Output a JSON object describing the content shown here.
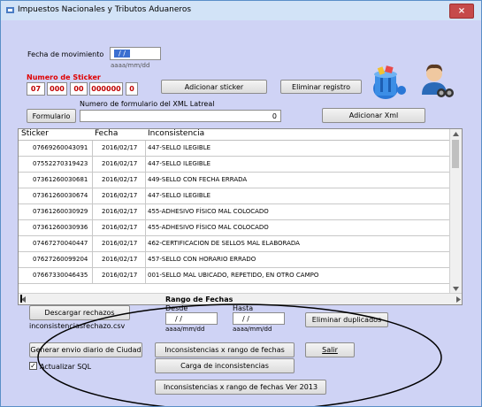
{
  "window": {
    "title": "Impuestos Nacionales y Tributos Aduaneros",
    "close_label": "×"
  },
  "fecha": {
    "label": "Fecha de movimiento",
    "value": " / /",
    "format": "aaaa/mm/dd"
  },
  "sticker": {
    "label": "Numero de Sticker",
    "parts": [
      "07",
      "000",
      "00",
      "000000",
      "0"
    ]
  },
  "buttons": {
    "adicionar_sticker": "Adicionar sticker",
    "eliminar_registro": "Eliminar registro",
    "formulario": "Formulario",
    "adicionar_xml": "Adicionar Xml",
    "descargar_rechazos": "Descargar rechazos",
    "eliminar_duplicados": "Eliminar duplicados",
    "generar_envio": "Generar envio diario de Ciudad",
    "inconsistencias_rango": "Inconsistencias x rango de fechas",
    "salir": "Salir",
    "carga_inconsistencias": "Carga de inconsistencias",
    "inconsistencias_2013": "Inconsistencias x rango de fechas Ver 2013"
  },
  "formulario": {
    "label": "Numero de formulario del XML Latreal",
    "value": "0"
  },
  "table": {
    "headers": [
      "Sticker",
      "Fecha",
      "Inconsistencia"
    ],
    "rows": [
      [
        "07669260043091",
        "2016/02/17",
        "447-SELLO ILEGIBLE"
      ],
      [
        "07552270319423",
        "2016/02/17",
        "447-SELLO ILEGIBLE"
      ],
      [
        "07361260030681",
        "2016/02/17",
        "449-SELLO CON FECHA ERRADA"
      ],
      [
        "07361260030674",
        "2016/02/17",
        "447-SELLO ILEGIBLE"
      ],
      [
        "07361260030929",
        "2016/02/17",
        "455-ADHESIVO FÍSICO MAL COLOCADO"
      ],
      [
        "07361260030936",
        "2016/02/17",
        "455-ADHESIVO FÍSICO MAL COLOCADO"
      ],
      [
        "07467270040447",
        "2016/02/17",
        "462-CERTIFICACION DE SELLOS MAL ELABORADA"
      ],
      [
        "07627260099204",
        "2016/02/17",
        "457-SELLO CON HORARIO ERRADO"
      ],
      [
        "07667330046435",
        "2016/02/17",
        "001-SELLO MAL UBICADO, REPETIDO, EN OTRO CAMPO"
      ]
    ]
  },
  "rango": {
    "label": "Rango de Fechas",
    "desde_label": "Desde",
    "desde_value": " / /",
    "hasta_label": "Hasta",
    "hasta_value": " / /",
    "format": "aaaa/mm/dd"
  },
  "rechazos_file": "inconsistenciasrechazo.csv",
  "actualizar_sql": {
    "label": "Actualizar SQL",
    "checked": true
  },
  "colors": {
    "sticker_red": "#c00000",
    "background": "#cfd3f5",
    "close": "#c64a4a"
  }
}
